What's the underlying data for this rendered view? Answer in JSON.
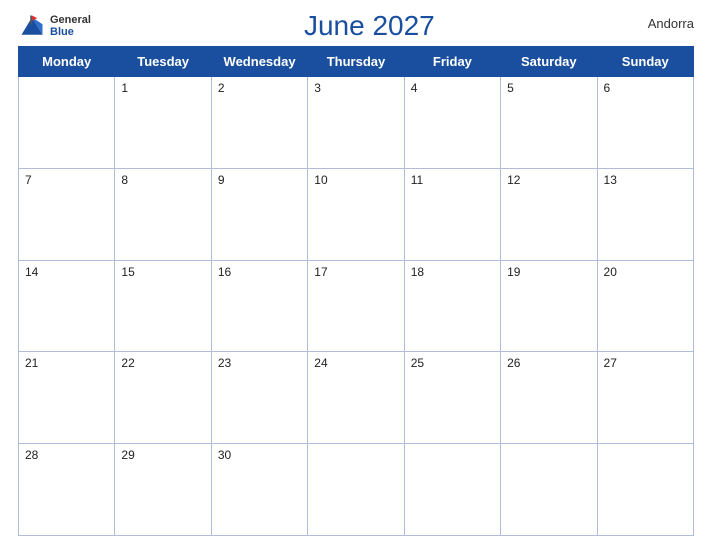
{
  "header": {
    "logo_general": "General",
    "logo_blue": "Blue",
    "title": "June 2027",
    "country": "Andorra"
  },
  "calendar": {
    "days_of_week": [
      "Monday",
      "Tuesday",
      "Wednesday",
      "Thursday",
      "Friday",
      "Saturday",
      "Sunday"
    ],
    "weeks": [
      [
        null,
        "1",
        "2",
        "3",
        "4",
        "5",
        "6"
      ],
      [
        "7",
        "8",
        "9",
        "10",
        "11",
        "12",
        "13"
      ],
      [
        "14",
        "15",
        "16",
        "17",
        "18",
        "19",
        "20"
      ],
      [
        "21",
        "22",
        "23",
        "24",
        "25",
        "26",
        "27"
      ],
      [
        "28",
        "29",
        "30",
        null,
        null,
        null,
        null
      ]
    ]
  }
}
